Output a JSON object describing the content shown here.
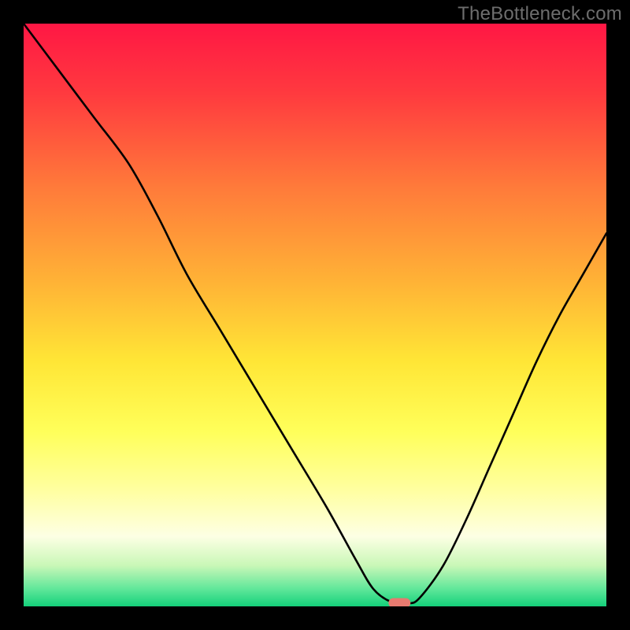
{
  "attribution": "TheBottleneck.com",
  "chart_data": {
    "type": "line",
    "title": "",
    "xlabel": "",
    "ylabel": "",
    "xlim": [
      0,
      100
    ],
    "ylim": [
      0,
      100
    ],
    "grid": false,
    "legend": false,
    "series": [
      {
        "name": "curve",
        "x": [
          0,
          6,
          12,
          18,
          23,
          28,
          34,
          40,
          46,
          52,
          57,
          60,
          63,
          66,
          68,
          72,
          76,
          80,
          84,
          88,
          92,
          96,
          100
        ],
        "y": [
          100,
          92,
          84,
          76,
          67,
          57,
          47,
          37,
          27,
          17,
          8,
          3,
          0.8,
          0.5,
          1.5,
          7,
          15,
          24,
          33,
          42,
          50,
          57,
          64
        ]
      }
    ],
    "marker": {
      "x": 64.5,
      "y": 0.6,
      "color": "#e77a6f"
    },
    "gradient_stops": [
      {
        "pct": 0,
        "color": "#ff1744"
      },
      {
        "pct": 12,
        "color": "#ff3a3f"
      },
      {
        "pct": 28,
        "color": "#ff7a3a"
      },
      {
        "pct": 45,
        "color": "#ffb536"
      },
      {
        "pct": 58,
        "color": "#ffe636"
      },
      {
        "pct": 70,
        "color": "#ffff5a"
      },
      {
        "pct": 80,
        "color": "#ffffa0"
      },
      {
        "pct": 88,
        "color": "#fdffe4"
      },
      {
        "pct": 93,
        "color": "#c9f7b7"
      },
      {
        "pct": 97,
        "color": "#60e79a"
      },
      {
        "pct": 100,
        "color": "#14d07a"
      }
    ]
  }
}
